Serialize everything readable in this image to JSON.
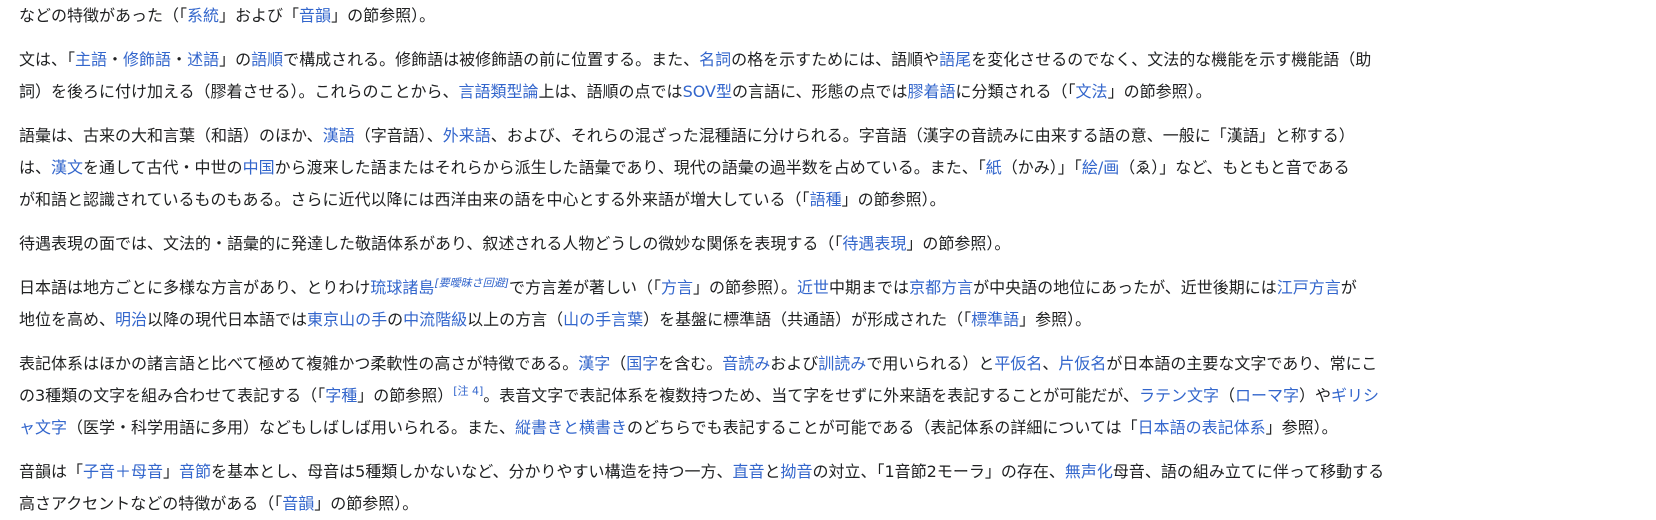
{
  "paragraphs": [
    {
      "name": "para-intro-continuation",
      "lines": [
        [
          {
            "t": "などの特徴があった（「"
          },
          {
            "t": "系統",
            "link": true
          },
          {
            "t": "」および「"
          },
          {
            "t": "音韻",
            "link": true
          },
          {
            "t": "」の節参照）。"
          }
        ]
      ]
    },
    {
      "name": "para-grammar",
      "lines": [
        [
          {
            "t": "文は、「"
          },
          {
            "t": "主語",
            "link": true
          },
          {
            "t": "・"
          },
          {
            "t": "修飾語",
            "link": true
          },
          {
            "t": "・"
          },
          {
            "t": "述語",
            "link": true
          },
          {
            "t": "」の"
          },
          {
            "t": "語順",
            "link": true
          },
          {
            "t": "で構成される。修飾語は被修飾語の前に位置する。また、"
          },
          {
            "t": "名詞",
            "link": true
          },
          {
            "t": "の格を示すためには、語順や"
          },
          {
            "t": "語尾",
            "link": true
          },
          {
            "t": "を変化させるのでなく、文法的な機能を示す機能語（助"
          }
        ],
        [
          {
            "t": "詞）を後ろに付け加える（膠着させる）。これらのことから、"
          },
          {
            "t": "言語類型論",
            "link": true
          },
          {
            "t": "上は、語順の点では"
          },
          {
            "t": "SOV型",
            "link": true
          },
          {
            "t": "の言語に、形態の点では"
          },
          {
            "t": "膠着語",
            "link": true
          },
          {
            "t": "に分類される（「"
          },
          {
            "t": "文法",
            "link": true
          },
          {
            "t": "」の節参照）。"
          }
        ]
      ]
    },
    {
      "name": "para-vocabulary",
      "lines": [
        [
          {
            "t": "語彙は、古来の大和言葉（和語）のほか、"
          },
          {
            "t": "漢語",
            "link": true
          },
          {
            "t": "（字音語）、"
          },
          {
            "t": "外来語",
            "link": true
          },
          {
            "t": "、および、それらの混ざった混種語に分けられる。字音語（漢字の音読みに由来する語の意、一般に「漢語」と称する）"
          }
        ],
        [
          {
            "t": "は、"
          },
          {
            "t": "漢文",
            "link": true
          },
          {
            "t": "を通して古代・中世の"
          },
          {
            "t": "中国",
            "link": true
          },
          {
            "t": "から渡来した語またはそれらから派生した語彙であり、現代の語彙の過半数を占めている。また、「"
          },
          {
            "t": "紙",
            "link": true
          },
          {
            "t": "（かみ）」「"
          },
          {
            "t": "絵/画",
            "link": true
          },
          {
            "t": "（ゑ）」など、もともと音である"
          }
        ],
        [
          {
            "t": "が和語と認識されているものもある。さらに近代以降には西洋由来の語を中心とする外来語が増大している（「"
          },
          {
            "t": "語種",
            "link": true
          },
          {
            "t": "」の節参照）。"
          }
        ]
      ]
    },
    {
      "name": "para-honorifics",
      "lines": [
        [
          {
            "t": "待遇表現の面では、文法的・語彙的に発達した敬語体系があり、叙述される人物どうしの微妙な関係を表現する（「"
          },
          {
            "t": "待遇表現",
            "link": true
          },
          {
            "t": "」の節参照）。"
          }
        ]
      ]
    },
    {
      "name": "para-dialects",
      "lines": [
        [
          {
            "t": "日本語は地方ごとに多様な方言があり、とりわけ"
          },
          {
            "t": "琉球諸島",
            "link": true
          },
          {
            "t": "[要曖昧さ回避]",
            "sup": true,
            "link": true,
            "italic": true
          },
          {
            "t": "で方言差が著しい（「"
          },
          {
            "t": "方言",
            "link": true
          },
          {
            "t": "」の節参照）。"
          },
          {
            "t": "近世",
            "link": true
          },
          {
            "t": "中期までは"
          },
          {
            "t": "京都方言",
            "link": true
          },
          {
            "t": "が中央語の地位にあったが、近世後期には"
          },
          {
            "t": "江戸方言",
            "link": true
          },
          {
            "t": "が"
          }
        ],
        [
          {
            "t": "地位を高め、"
          },
          {
            "t": "明治",
            "link": true
          },
          {
            "t": "以降の現代日本語では"
          },
          {
            "t": "東京",
            "link": true
          },
          {
            "t": "山の手",
            "link": true
          },
          {
            "t": "の"
          },
          {
            "t": "中流階級",
            "link": true
          },
          {
            "t": "以上の方言（"
          },
          {
            "t": "山の手言葉",
            "link": true
          },
          {
            "t": "）を基盤に標準語（共通語）が形成された（「"
          },
          {
            "t": "標準語",
            "link": true
          },
          {
            "t": "」参照）。"
          }
        ]
      ]
    },
    {
      "name": "para-writing-system",
      "lines": [
        [
          {
            "t": "表記体系はほかの諸言語と比べて極めて複雑かつ柔軟性の高さが特徴である。"
          },
          {
            "t": "漢字",
            "link": true
          },
          {
            "t": "（"
          },
          {
            "t": "国字",
            "link": true
          },
          {
            "t": "を含む。"
          },
          {
            "t": "音読み",
            "link": true
          },
          {
            "t": "および"
          },
          {
            "t": "訓読み",
            "link": true
          },
          {
            "t": "で用いられる）と"
          },
          {
            "t": "平仮名",
            "link": true
          },
          {
            "t": "、"
          },
          {
            "t": "片仮名",
            "link": true
          },
          {
            "t": "が日本語の主要な文字であり、常にこ"
          }
        ],
        [
          {
            "t": "の3種類の文字を組み合わせて表記する（「"
          },
          {
            "t": "字種",
            "link": true
          },
          {
            "t": "」の節参照）"
          },
          {
            "t": "[注 4]",
            "sup": true,
            "link": true
          },
          {
            "t": "。表音文字で表記体系を複数持つため、当て字をせずに外来語を表記することが可能だが、"
          },
          {
            "t": "ラテン文字",
            "link": true
          },
          {
            "t": "（"
          },
          {
            "t": "ローマ字",
            "link": true
          },
          {
            "t": "）や"
          },
          {
            "t": "ギリシ",
            "link": true
          }
        ],
        [
          {
            "t": "ャ文字",
            "link": true
          },
          {
            "t": "（医学・科学用語に多用）などもしばしば用いられる。また、"
          },
          {
            "t": "縦書きと横書き",
            "link": true
          },
          {
            "t": "のどちらでも表記することが可能である（表記体系の詳細については「"
          },
          {
            "t": "日本語の表記体系",
            "link": true
          },
          {
            "t": "」参照）。"
          }
        ]
      ]
    },
    {
      "name": "para-phonology",
      "lines": [
        [
          {
            "t": "音韻は「"
          },
          {
            "t": "子音＋母音",
            "link": true
          },
          {
            "t": "」"
          },
          {
            "t": "音節",
            "link": true
          },
          {
            "t": "を基本とし、母音は5種類しかないなど、分かりやすい構造を持つ一方、"
          },
          {
            "t": "直音",
            "link": true
          },
          {
            "t": "と"
          },
          {
            "t": "拗音",
            "link": true
          },
          {
            "t": "の対立、「1音節2モーラ」の存在、"
          },
          {
            "t": "無声化",
            "link": true
          },
          {
            "t": "母音、語の組み立てに伴って移動する"
          }
        ],
        [
          {
            "t": "高さアクセントなどの特徴がある（「"
          },
          {
            "t": "音韻",
            "link": true
          },
          {
            "t": "」の節参照）。"
          }
        ]
      ]
    }
  ]
}
